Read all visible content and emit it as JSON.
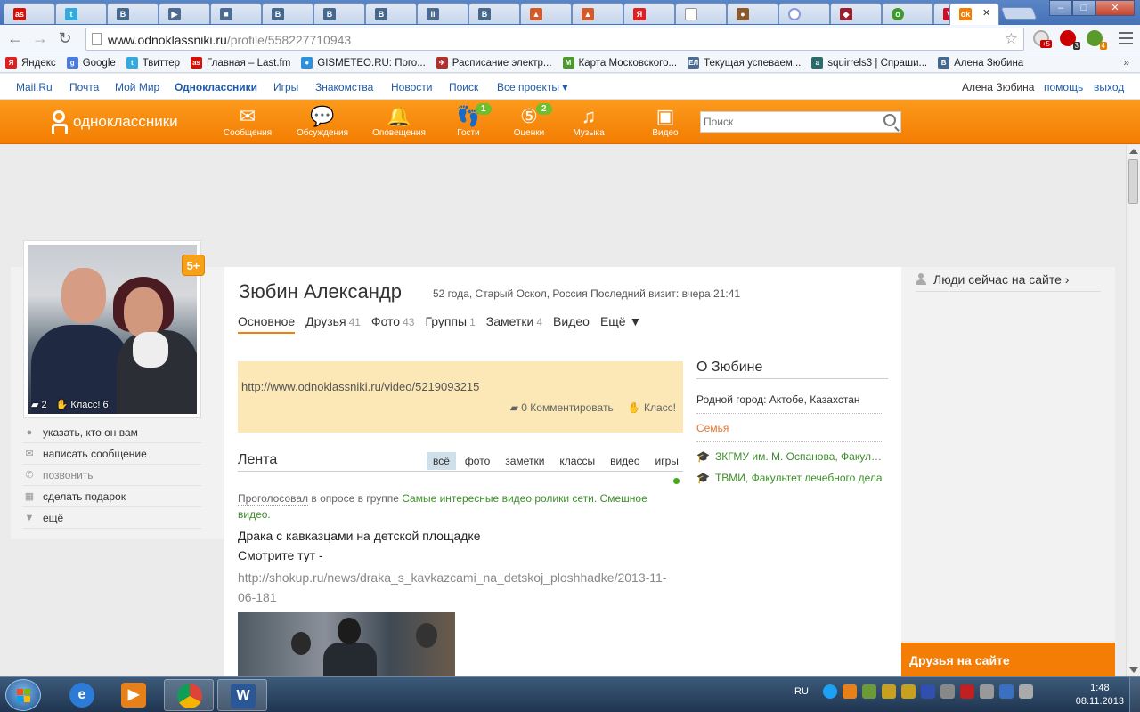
{
  "browser": {
    "url_domain": "www.odnoklassniki.ru",
    "url_path": "/profile/558227710943",
    "active_tab_icon": "odnoklassniki-icon",
    "window_buttons": {
      "minimize": "–",
      "maximize": "□",
      "close": "✕"
    }
  },
  "bookmarks": [
    {
      "label": "Яндекс",
      "icon": "yandex-icon",
      "color": "#e02020",
      "glyph": "Я"
    },
    {
      "label": "Google",
      "icon": "google-icon",
      "color": "#4a7be0",
      "glyph": "g"
    },
    {
      "label": "Твиттер",
      "icon": "twitter-icon",
      "color": "#33aadd",
      "glyph": "t"
    },
    {
      "label": "Главная – Last.fm",
      "icon": "lastfm-icon",
      "color": "#d51007",
      "glyph": "as"
    },
    {
      "label": "GISMETEO.RU: Пого...",
      "icon": "gismeteo-icon",
      "color": "#2f8fd8",
      "glyph": "●"
    },
    {
      "label": "Расписание электр...",
      "icon": "train-icon",
      "color": "#b03030",
      "glyph": "✈"
    },
    {
      "label": "Карта Московского...",
      "icon": "metro-icon",
      "color": "#4b9a2a",
      "glyph": "M"
    },
    {
      "label": "Текущая успеваем...",
      "icon": "grades-icon",
      "color": "#4c6a92",
      "glyph": "ЕЛ"
    },
    {
      "label": "squirrels3 | Спраши...",
      "icon": "askfm-icon",
      "color": "#2b6b6b",
      "glyph": "a"
    },
    {
      "label": "Алена Зюбина",
      "icon": "vk-icon",
      "color": "#45688e",
      "glyph": "B"
    }
  ],
  "mailbar": {
    "links": [
      "Mail.Ru",
      "Почта",
      "Мой Мир",
      "Одноклассники",
      "Игры",
      "Знакомства",
      "Новости",
      "Поиск",
      "Все проекты ▾"
    ],
    "current": "Одноклассники",
    "user": "Алена Зюбина",
    "help": "помощь",
    "logout": "выход"
  },
  "oknav": {
    "logo": "одноклассники",
    "items": [
      {
        "label": "Сообщения",
        "icon": "envelope-icon",
        "glyph": "✉",
        "count": ""
      },
      {
        "label": "Обсуждения",
        "icon": "chat-bubbles-icon",
        "glyph": "💬",
        "count": ""
      },
      {
        "label": "Оповещения",
        "icon": "bell-icon",
        "glyph": "🔔",
        "count": ""
      },
      {
        "label": "Гости",
        "icon": "footprints-icon",
        "glyph": "👣",
        "count": "1"
      },
      {
        "label": "Оценки",
        "icon": "rating-icon",
        "glyph": "⑤",
        "count": "2"
      },
      {
        "label": "Музыка",
        "icon": "music-icon",
        "glyph": "♫",
        "count": ""
      },
      {
        "label": "Видео",
        "icon": "video-icon",
        "glyph": "▣",
        "count": ""
      }
    ],
    "search_placeholder": "Поиск"
  },
  "profile": {
    "name": "Зюбин Александр",
    "meta": "52 года, Старый Оскол, Россия  Последний визит: вчера 21:41",
    "photo_comments": "2",
    "photo_likes": "Класс! 6",
    "badge": "5+",
    "tabs": [
      {
        "label": "Основное",
        "count": ""
      },
      {
        "label": "Друзья",
        "count": "41"
      },
      {
        "label": "Фото",
        "count": "43"
      },
      {
        "label": "Группы",
        "count": "1"
      },
      {
        "label": "Заметки",
        "count": "4"
      },
      {
        "label": "Видео",
        "count": ""
      },
      {
        "label": "Ещё ▼",
        "count": ""
      }
    ],
    "actions": [
      {
        "label": "указать, кто он вам",
        "icon": "pin-icon",
        "glyph": "●"
      },
      {
        "label": "написать сообщение",
        "icon": "envelope-icon",
        "glyph": "✉"
      },
      {
        "label": "позвонить",
        "icon": "phone-icon",
        "glyph": "✆"
      },
      {
        "label": "сделать подарок",
        "icon": "gift-icon",
        "glyph": "▦"
      },
      {
        "label": "ещё",
        "icon": "triangle-down-icon",
        "glyph": "▼"
      }
    ]
  },
  "status": {
    "link": "http://www.odnoklassniki.ru/video/5219093215",
    "comment": "0 Комментировать",
    "like": "Класс!"
  },
  "about": {
    "title": "О Зюбине",
    "hometown": "Родной город: Актобе, Казахстан",
    "family": "Семья",
    "edu1": "ЗКГМУ им. М. Оспанова, Факультет",
    "edu2": "ТВМИ, Факультет лечебного дела"
  },
  "feed": {
    "title": "Лента",
    "tabs": [
      "всё",
      "фото",
      "заметки",
      "классы",
      "видео",
      "игры"
    ],
    "voted": "Проголосовал",
    "in_group": " в опросе в группе ",
    "group": "Самые интересные видео ролики сети. Смешное видео.",
    "post_title": "Драка с кавказцами на детской площадке",
    "post_body": "Смотрите тут -",
    "post_link": "http://shokup.ru/news/draka_s_kavkazcami_na_detskoj_ploshhadke/2013-11-06-181"
  },
  "sidebar": {
    "people_now": "Люди сейчас на сайте ›",
    "friends_online": "Друзья на сайте"
  },
  "taskbar": {
    "lang": "RU",
    "time": "1:48",
    "date": "08.11.2013"
  }
}
